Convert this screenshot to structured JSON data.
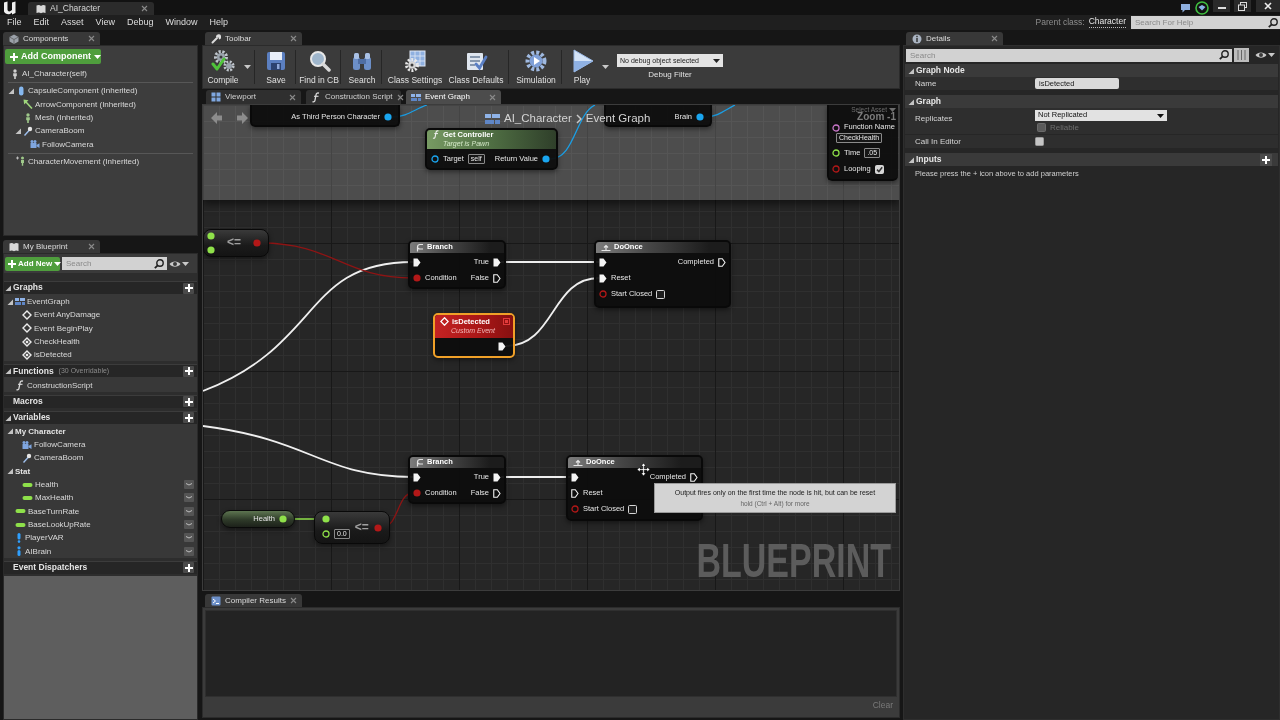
{
  "title_bar": {
    "tab": "AI_Character"
  },
  "menu": [
    "File",
    "Edit",
    "Asset",
    "View",
    "Debug",
    "Window",
    "Help"
  ],
  "help_bar": {
    "parent_class_label": "Parent class:",
    "parent_class": "Character",
    "search": {
      "placeholder": "Search For Help"
    }
  },
  "components": {
    "tab": "Components",
    "add_button": "Add Component",
    "root": {
      "label": "AI_Character(self)",
      "kind": "actor"
    },
    "tree": [
      {
        "label": "CapsuleComponent (Inherited)",
        "kind": "capsule",
        "expanded": true,
        "children": [
          {
            "label": "ArrowComponent (Inherited)",
            "kind": "arrow"
          },
          {
            "label": "Mesh (Inherited)",
            "kind": "mesh"
          },
          {
            "label": "CameraBoom",
            "kind": "boom",
            "expanded": true,
            "children": [
              {
                "label": "FollowCamera",
                "kind": "camera"
              }
            ]
          }
        ]
      }
    ],
    "other": [
      {
        "label": "CharacterMovement (Inherited)",
        "kind": "movement"
      }
    ]
  },
  "my_blueprint": {
    "tab": "My Blueprint",
    "add_button": "Add New",
    "search": {
      "placeholder": "Search"
    },
    "sections": [
      {
        "title": "Graphs",
        "expanded": true,
        "add": true,
        "items": [
          {
            "label": "EventGraph",
            "kind": "graph",
            "expanded": true,
            "children": [
              {
                "label": "Event AnyDamage",
                "kind": "event"
              },
              {
                "label": "Event BeginPlay",
                "kind": "event"
              },
              {
                "label": "CheckHealth",
                "kind": "custom_event"
              },
              {
                "label": "isDetected",
                "kind": "custom_event"
              }
            ]
          }
        ]
      },
      {
        "title": "Functions",
        "note": "(30 Overridable)",
        "expanded": true,
        "add": true,
        "items": [
          {
            "label": "ConstructionScript",
            "kind": "function"
          }
        ]
      },
      {
        "title": "Macros",
        "add": true
      },
      {
        "title": "Variables",
        "expanded": true,
        "add": true,
        "items": [
          {
            "label": "My Character",
            "kind": "category",
            "expanded": true,
            "children": [
              {
                "label": "FollowCamera",
                "kind": "camera"
              },
              {
                "label": "CameraBoom",
                "kind": "boom"
              }
            ]
          },
          {
            "label": "Stat",
            "kind": "category",
            "expanded": true,
            "children": [
              {
                "label": "Health",
                "kind": "float"
              },
              {
                "label": "MaxHealth",
                "kind": "float"
              }
            ]
          },
          {
            "label": "BaseTurnRate",
            "kind": "float"
          },
          {
            "label": "BaseLookUpRate",
            "kind": "float"
          },
          {
            "label": "PlayerVAR",
            "kind": "actor_ref"
          },
          {
            "label": "AIBrain",
            "kind": "brain_ref"
          }
        ]
      },
      {
        "title": "Event Dispatchers",
        "add": true
      }
    ]
  },
  "toolbar": {
    "tab": "Toolbar",
    "buttons": [
      {
        "label": "Compile",
        "kind": "compile",
        "menu": true
      },
      {
        "label": "Save",
        "kind": "save"
      },
      {
        "label": "Find in CB",
        "kind": "find"
      },
      {
        "label": "Search",
        "kind": "search"
      },
      {
        "label": "Class Settings",
        "kind": "settings"
      },
      {
        "label": "Class Defaults",
        "kind": "defaults"
      },
      {
        "label": "Simulation",
        "kind": "simulation"
      },
      {
        "label": "Play",
        "kind": "play",
        "menu": true
      }
    ],
    "debug": {
      "value": "No debug object selected",
      "label": "Debug Filter"
    }
  },
  "graph": {
    "tabs": [
      {
        "label": "Viewport",
        "kind": "viewport",
        "selected": false
      },
      {
        "label": "Construction Script",
        "kind": "function",
        "selected": false
      },
      {
        "label": "Event Graph",
        "kind": "graph",
        "selected": true
      }
    ],
    "breadcrumb": [
      "AI_Character",
      "Event Graph"
    ],
    "zoom": "Zoom -1",
    "nodes": [
      {
        "kind": "fragment",
        "selected": false,
        "outputs": [
          {
            "label": "As Third Person Character",
            "kind": "object",
            "connected": true
          }
        ]
      },
      {
        "kind": "fragment",
        "selected": false,
        "outputs": [
          {
            "label": "Brain",
            "kind": "object",
            "connected": true
          }
        ]
      },
      {
        "kind": "fragment",
        "selected": false,
        "inputs": [
          {
            "kind": "asset",
            "value": "Select Asset"
          },
          {
            "label": "Function Name",
            "kind": "name",
            "connected": false,
            "value": "CheckHealth"
          },
          {
            "label": "Time",
            "kind": "float",
            "connected": false,
            "value": ".05"
          },
          {
            "label": "Looping",
            "kind": "bool",
            "connected": false,
            "checked": true
          }
        ]
      },
      {
        "kind": "function",
        "title": "Get Controller",
        "subtitle": "Target is Pawn",
        "selected": false,
        "inputs": [
          {
            "label": "Target",
            "kind": "object",
            "connected": false,
            "value": "self"
          }
        ],
        "outputs": [
          {
            "label": "Return Value",
            "kind": "object",
            "connected": true
          }
        ]
      },
      {
        "kind": "operator",
        "symbol": "<=",
        "selected": false,
        "inputs": [
          {
            "kind": "float",
            "connected": true
          },
          {
            "kind": "float",
            "connected": true
          }
        ],
        "outputs": [
          {
            "kind": "bool",
            "connected": true
          }
        ]
      },
      {
        "kind": "branch",
        "title": "Branch",
        "selected": false,
        "inputs": [
          {
            "kind": "exec",
            "connected": true
          },
          {
            "label": "Condition",
            "kind": "bool",
            "connected": true
          }
        ],
        "outputs": [
          {
            "label": "True",
            "kind": "exec",
            "connected": true
          },
          {
            "label": "False",
            "kind": "exec",
            "connected": false
          }
        ]
      },
      {
        "kind": "doonce",
        "title": "DoOnce",
        "selected": false,
        "inputs": [
          {
            "kind": "exec",
            "connected": true
          },
          {
            "label": "Reset",
            "kind": "exec",
            "connected": true
          },
          {
            "label": "Start Closed",
            "kind": "bool",
            "connected": false,
            "checked": false
          }
        ],
        "outputs": [
          {
            "label": "Completed",
            "kind": "exec",
            "connected": false
          }
        ]
      },
      {
        "kind": "event",
        "title": "isDetected",
        "subtitle": "Custom Event",
        "selected": true,
        "outputs": [
          {
            "kind": "delegate",
            "connected": false
          },
          {
            "kind": "exec",
            "connected": true
          }
        ]
      },
      {
        "kind": "branch",
        "title": "Branch",
        "selected": false,
        "inputs": [
          {
            "kind": "exec",
            "connected": true
          },
          {
            "label": "Condition",
            "kind": "bool",
            "connected": true
          }
        ],
        "outputs": [
          {
            "label": "True",
            "kind": "exec",
            "connected": true
          },
          {
            "label": "False",
            "kind": "exec",
            "connected": false
          }
        ]
      },
      {
        "kind": "doonce",
        "title": "DoOnce",
        "selected": false,
        "inputs": [
          {
            "kind": "exec",
            "connected": true
          },
          {
            "label": "Reset",
            "kind": "exec",
            "connected": false
          },
          {
            "label": "Start Closed",
            "kind": "bool",
            "connected": false,
            "checked": false
          }
        ],
        "outputs": [
          {
            "label": "Completed",
            "kind": "exec",
            "connected": false
          }
        ]
      },
      {
        "kind": "getter",
        "selected": false,
        "outputs": [
          {
            "label": "Health",
            "kind": "float",
            "connected": true
          }
        ]
      },
      {
        "kind": "operator",
        "symbol": "<=",
        "selected": false,
        "inputs": [
          {
            "kind": "float",
            "connected": true
          },
          {
            "kind": "float",
            "connected": false,
            "value": "0.0"
          }
        ],
        "outputs": [
          {
            "kind": "bool",
            "connected": true
          }
        ]
      }
    ],
    "tooltip": {
      "text": "Output fires only on the first time the node is hit, but can be reset",
      "hint": "hold (Ctrl + Alt) for more"
    },
    "corner_label": "BLUEPRINT"
  },
  "compiler_results": {
    "tab": "Compiler Results",
    "clear_button": "Clear"
  },
  "details": {
    "tab": "Details",
    "search": {
      "placeholder": "Search"
    },
    "sections": [
      {
        "title": "Graph Node",
        "expanded": true,
        "rows": [
          {
            "label": "Name",
            "kind": "text",
            "value": "isDetected"
          }
        ]
      },
      {
        "title": "Graph",
        "expanded": true,
        "rows": [
          {
            "label": "Replicates",
            "kind": "dropdown",
            "value": "Not Replicated",
            "sub_option": {
              "label": "Reliable",
              "checked": false,
              "disabled": true
            }
          },
          {
            "label": "Call In Editor",
            "kind": "checkbox",
            "checked": false
          }
        ]
      },
      {
        "title": "Inputs",
        "expanded": true,
        "add": true,
        "note": "Please press the + icon above to add parameters"
      }
    ]
  }
}
